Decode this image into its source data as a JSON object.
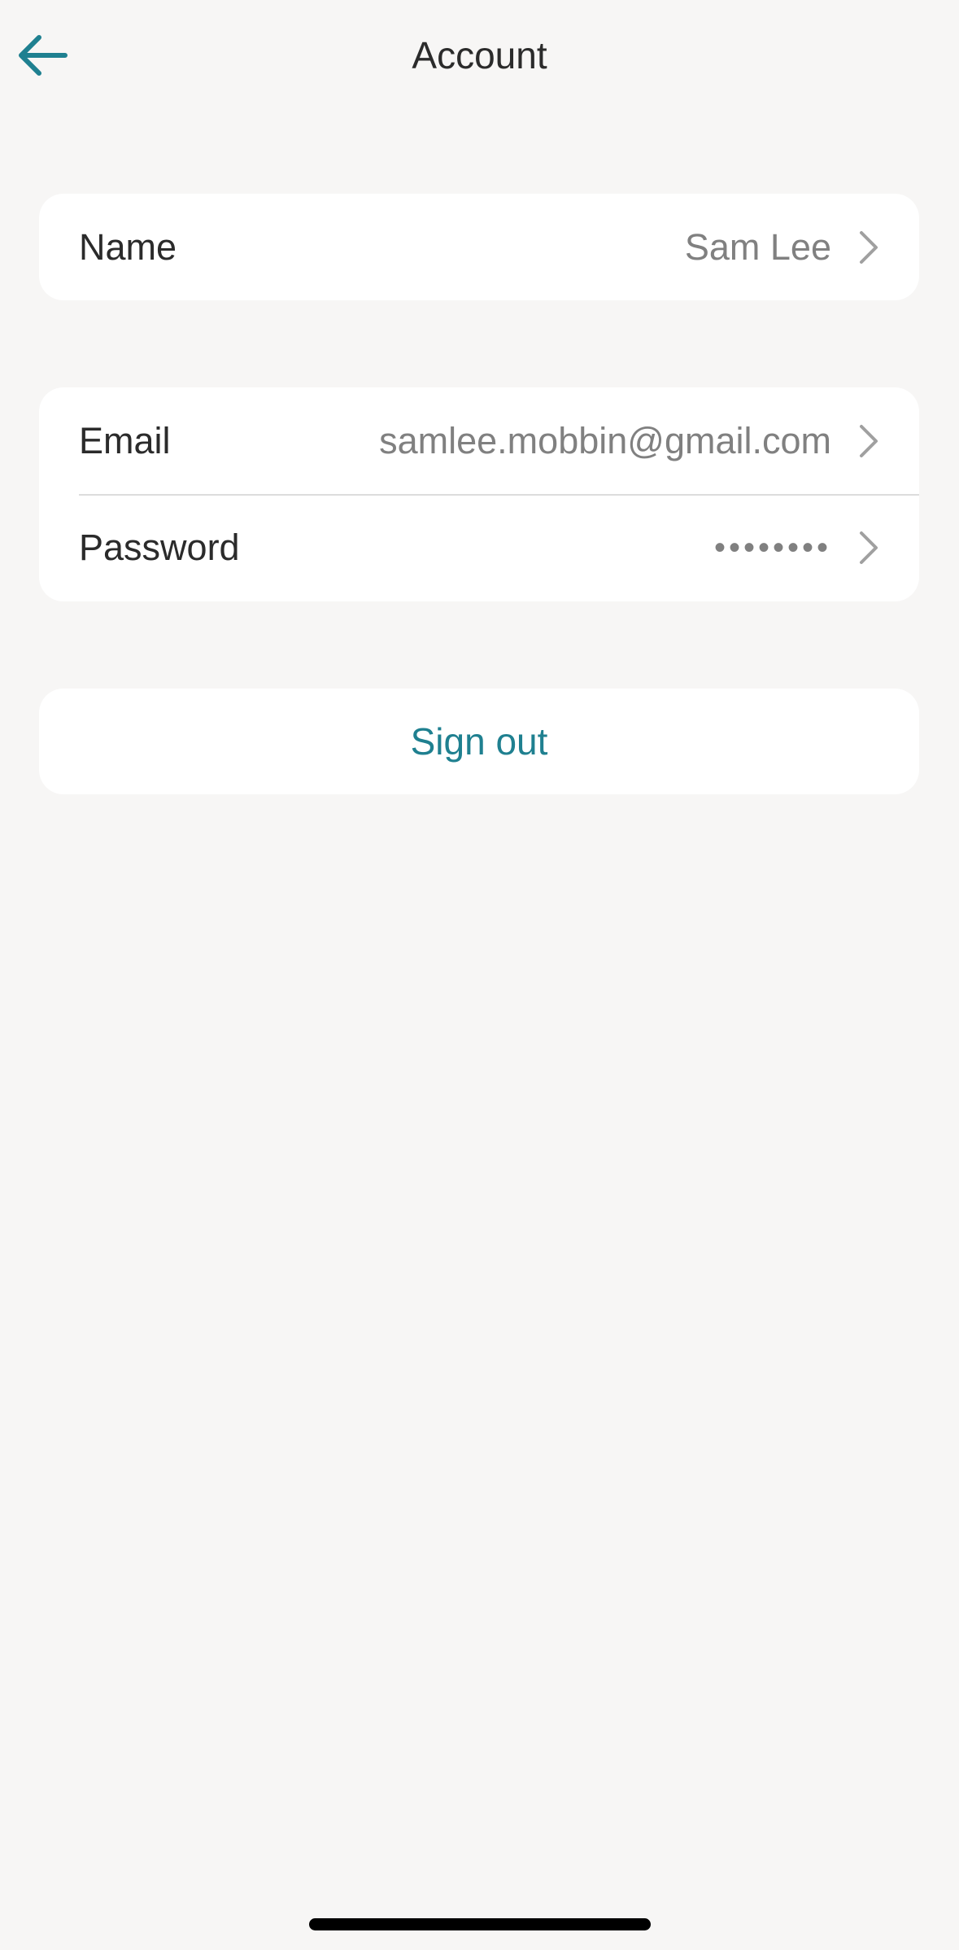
{
  "header": {
    "title": "Account",
    "back_icon": "arrow-left-icon"
  },
  "profile": {
    "name_label": "Name",
    "name_value": "Sam Lee"
  },
  "credentials": {
    "email_label": "Email",
    "email_value": "samlee.mobbin@gmail.com",
    "password_label": "Password",
    "password_value": "••••••••"
  },
  "actions": {
    "signout_label": "Sign out"
  },
  "colors": {
    "accent": "#1f8090",
    "background": "#f7f6f5",
    "card": "#ffffff",
    "secondary_text": "#808080",
    "chevron": "#a0a0a0"
  }
}
